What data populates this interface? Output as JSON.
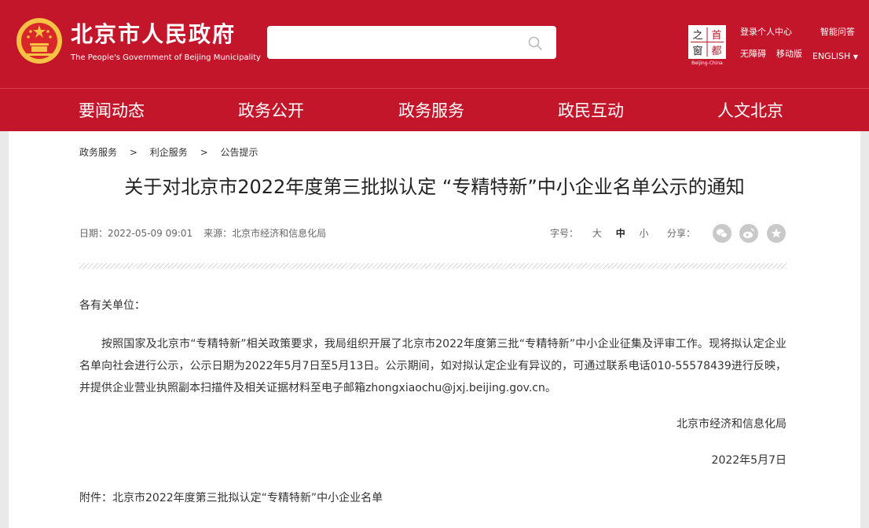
{
  "header": {
    "title": "北京市人民政府",
    "subtitle": "The People's Government of Beijing Municipality",
    "search": {
      "value": "",
      "placeholder": ""
    },
    "badge": {
      "chars": [
        "之",
        "首",
        "窗",
        "都"
      ],
      "caption": "Beijing-China"
    },
    "links": {
      "login": "登录个人中心",
      "smart_qa": "智能问答",
      "accessibility": "无障碍",
      "mobile": "移动版",
      "english": "ENGLISH"
    },
    "colors": {
      "brand": "#c4162a",
      "emblem_gold": "#f5c243"
    }
  },
  "nav": {
    "items": [
      "要闻动态",
      "政务公开",
      "政务服务",
      "政民互动",
      "人文北京"
    ]
  },
  "breadcrumb": {
    "items": [
      "政务服务",
      "利企服务",
      "公告提示"
    ],
    "separator": ">"
  },
  "article": {
    "title": "关于对北京市2022年度第三批拟认定 “专精特新”中小企业名单公示的通知",
    "date_label": "日期：",
    "date": "2022-05-09 09:01",
    "source_label": "来源：",
    "source": "北京市经济和信息化局",
    "font_size": {
      "label": "字号：",
      "large": "大",
      "medium": "中",
      "small": "小"
    },
    "share": {
      "label": "分享：",
      "icons": [
        "wechat-icon",
        "weibo-icon",
        "star-icon"
      ]
    },
    "salutation": "各有关单位：",
    "body": "按照国家及北京市“专精特新”相关政策要求，我局组织开展了北京市2022年度第三批“专精特新”中小企业征集及评审工作。现将拟认定企业名单向社会进行公示，公示日期为2022年5月7日至5月13日。公示期间，如对拟认定企业有异议的，可通过联系电话010-55578439进行反映，并提供企业营业执照副本扫描件及相关证据材料至电子邮箱zhongxiaochu@jxj.beijing.gov.cn。",
    "signature": "北京市经济和信息化局",
    "sign_date": "2022年5月7日",
    "attachment_label": "附件：",
    "attachment": "北京市2022年度第三批拟认定“专精特新”中小企业名单"
  }
}
